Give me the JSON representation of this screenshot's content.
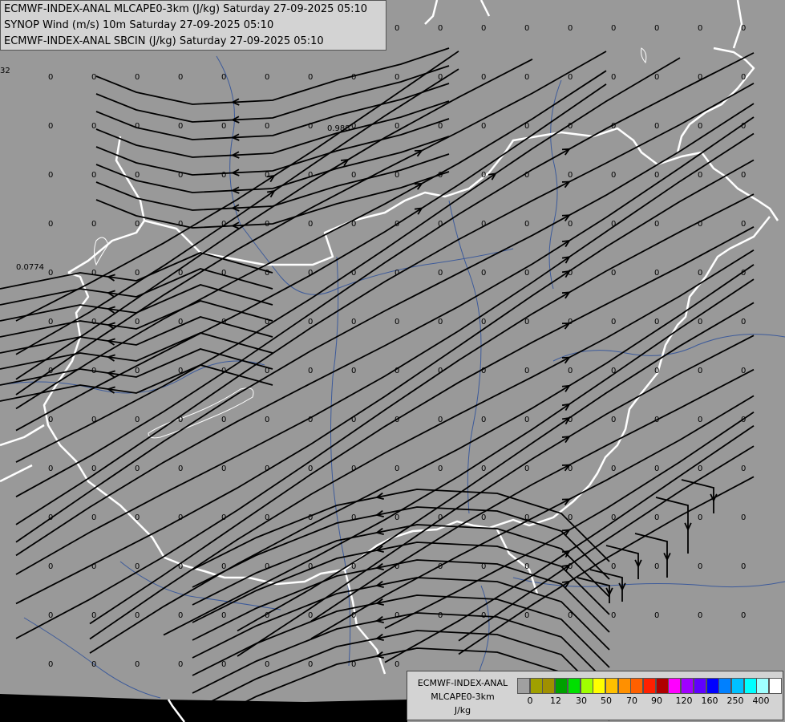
{
  "titles": [
    "ECMWF-INDEX-ANAL MLCAPE0-3km (J/kg) Saturday 27-09-2025 05:10",
    "SYNOP Wind (m/s) 10m Saturday 27-09-2025 05:10",
    "ECMWF-INDEX-ANAL SBCIN (J/kg) Saturday 27-09-2025 05:10"
  ],
  "map_labels": {
    "value_a": "32",
    "value_b": "0.988",
    "value_c": "0.0774",
    "zero": "0"
  },
  "legend": {
    "line1": "ECMWF-INDEX-ANAL",
    "line2": "MLCAPE0-3km",
    "unit": "J/kg",
    "colors": [
      "#a0a0a0",
      "#a0a000",
      "#a09000",
      "#00a000",
      "#00e000",
      "#a0ff00",
      "#ffff00",
      "#ffc000",
      "#ff9000",
      "#ff6000",
      "#ff2000",
      "#b00000",
      "#ff00ff",
      "#a000ff",
      "#6000ff",
      "#0000ff",
      "#0080ff",
      "#00c0ff",
      "#00ffff",
      "#a0ffff",
      "#ffffff"
    ],
    "ticks": [
      "0",
      "12",
      "30",
      "50",
      "70",
      "90",
      "120",
      "160",
      "250",
      "400"
    ]
  },
  "colors": {
    "land": "#999999",
    "border": "#ffffff",
    "river": "#3c5a9a",
    "streamline": "#000000"
  }
}
